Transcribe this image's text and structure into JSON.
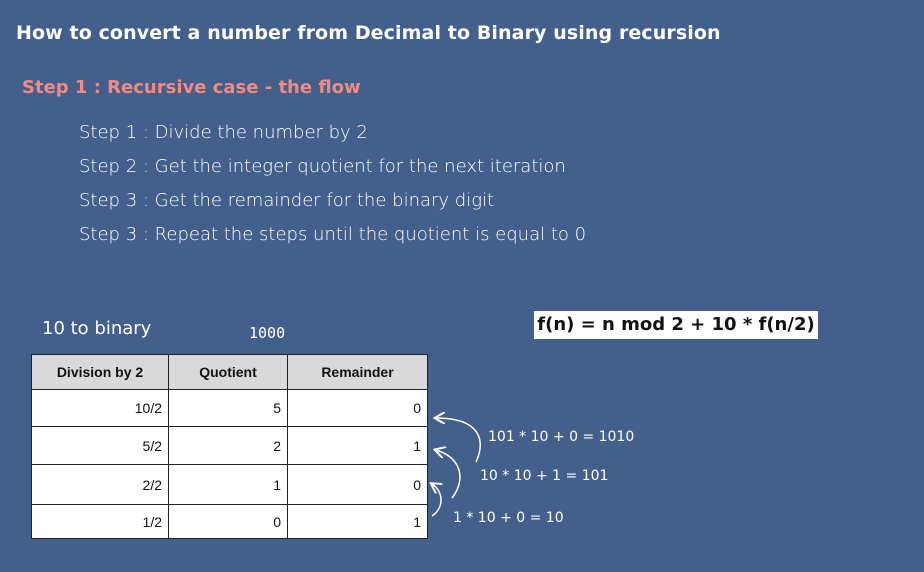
{
  "title": "How to convert a number from Decimal to Binary using recursion",
  "subtitle": "Step 1 : Recursive case - the flow",
  "steps": [
    "Step 1 : Divide the number by 2",
    "Step 2 : Get the integer quotient for the next iteration",
    "Step 3 : Get the remainder for the binary digit",
    "Step 3 : Repeat the steps until the quotient is equal to 0"
  ],
  "example": {
    "label": "10 to binary",
    "result": "1000"
  },
  "formula": "f(n) = n mod 2 + 10 * f(n/2)",
  "table": {
    "headers": [
      "Division by 2",
      "Quotient",
      "Remainder"
    ],
    "rows": [
      [
        "10/2",
        "5",
        "0"
      ],
      [
        "5/2",
        "2",
        "1"
      ],
      [
        "2/2",
        "1",
        "0"
      ],
      [
        "1/2",
        "0",
        "1"
      ]
    ]
  },
  "calculations": [
    "101 * 10 + 0 = 1010",
    "10 * 10 + 1 = 101",
    "1 * 10 + 0 = 10"
  ]
}
